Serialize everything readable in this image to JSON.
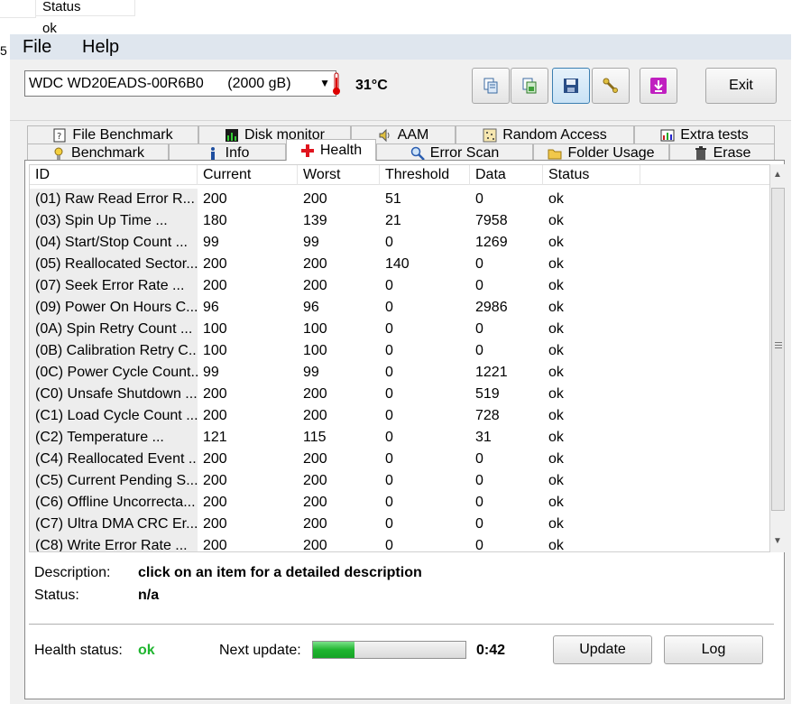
{
  "background": {
    "status_header": "Status",
    "status_value": "ok",
    "side_char": "5"
  },
  "menu": {
    "file": "File",
    "help": "Help"
  },
  "toolbar": {
    "drive": "WDC WD20EADS-00R6B0",
    "drive_size": "(2000 gB)",
    "temperature": "31°C",
    "exit_label": "Exit"
  },
  "tabs_top": [
    {
      "label": "File Benchmark",
      "icon": "file-benchmark-icon"
    },
    {
      "label": "Disk monitor",
      "icon": "disk-monitor-icon"
    },
    {
      "label": "AAM",
      "icon": "speaker-icon"
    },
    {
      "label": "Random Access",
      "icon": "random-access-icon"
    },
    {
      "label": "Extra tests",
      "icon": "extra-tests-icon"
    }
  ],
  "tabs_bottom": [
    {
      "label": "Benchmark",
      "icon": "benchmark-icon"
    },
    {
      "label": "Info",
      "icon": "info-icon"
    },
    {
      "label": "Health",
      "icon": "health-cross-icon"
    },
    {
      "label": "Error Scan",
      "icon": "magnifier-icon"
    },
    {
      "label": "Folder Usage",
      "icon": "folder-icon"
    },
    {
      "label": "Erase",
      "icon": "trash-icon"
    }
  ],
  "columns": [
    "ID",
    "Current",
    "Worst",
    "Threshold",
    "Data",
    "Status"
  ],
  "rows": [
    {
      "id": "(01) Raw Read Error R...",
      "current": "200",
      "worst": "200",
      "threshold": "51",
      "data": "0",
      "status": "ok"
    },
    {
      "id": "(03) Spin Up Time       ...",
      "current": "180",
      "worst": "139",
      "threshold": "21",
      "data": "7958",
      "status": "ok"
    },
    {
      "id": "(04) Start/Stop Count   ...",
      "current": "99",
      "worst": "99",
      "threshold": "0",
      "data": "1269",
      "status": "ok"
    },
    {
      "id": "(05) Reallocated Sector...",
      "current": "200",
      "worst": "200",
      "threshold": "140",
      "data": "0",
      "status": "ok"
    },
    {
      "id": "(07) Seek Error Rate    ...",
      "current": "200",
      "worst": "200",
      "threshold": "0",
      "data": "0",
      "status": "ok"
    },
    {
      "id": "(09) Power On Hours C...",
      "current": "96",
      "worst": "96",
      "threshold": "0",
      "data": "2986",
      "status": "ok"
    },
    {
      "id": "(0A) Spin Retry Count   ...",
      "current": "100",
      "worst": "100",
      "threshold": "0",
      "data": "0",
      "status": "ok"
    },
    {
      "id": "(0B) Calibration Retry C...",
      "current": "100",
      "worst": "100",
      "threshold": "0",
      "data": "0",
      "status": "ok"
    },
    {
      "id": "(0C) Power Cycle Count...",
      "current": "99",
      "worst": "99",
      "threshold": "0",
      "data": "1221",
      "status": "ok"
    },
    {
      "id": "(C0) Unsafe Shutdown ...",
      "current": "200",
      "worst": "200",
      "threshold": "0",
      "data": "519",
      "status": "ok"
    },
    {
      "id": "(C1) Load Cycle Count   ...",
      "current": "200",
      "worst": "200",
      "threshold": "0",
      "data": "728",
      "status": "ok"
    },
    {
      "id": "(C2) Temperature        ...",
      "current": "121",
      "worst": "115",
      "threshold": "0",
      "data": "31",
      "status": "ok"
    },
    {
      "id": "(C4) Reallocated Event ...",
      "current": "200",
      "worst": "200",
      "threshold": "0",
      "data": "0",
      "status": "ok"
    },
    {
      "id": "(C5) Current Pending S...",
      "current": "200",
      "worst": "200",
      "threshold": "0",
      "data": "0",
      "status": "ok"
    },
    {
      "id": "(C6) Offline Uncorrecta...",
      "current": "200",
      "worst": "200",
      "threshold": "0",
      "data": "0",
      "status": "ok"
    },
    {
      "id": "(C7) Ultra DMA CRC Er...",
      "current": "200",
      "worst": "200",
      "threshold": "0",
      "data": "0",
      "status": "ok"
    },
    {
      "id": "(C8) Write Error Rate   ...",
      "current": "200",
      "worst": "200",
      "threshold": "0",
      "data": "0",
      "status": "ok"
    }
  ],
  "description": {
    "label": "Description:",
    "value": "click on an item for a detailed description",
    "status_label": "Status:",
    "status_value": "n/a"
  },
  "footer": {
    "health_label": "Health status:",
    "health_value": "ok",
    "health_color": "#1fb52f",
    "next_update_label": "Next update:",
    "progress_fraction": 0.27,
    "countdown": "0:42",
    "update_label": "Update",
    "log_label": "Log"
  }
}
